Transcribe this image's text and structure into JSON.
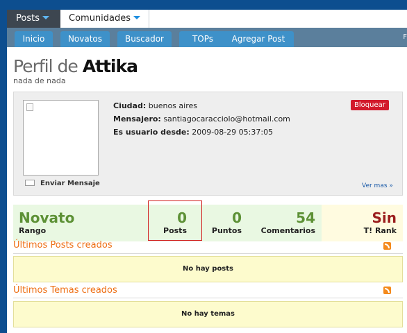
{
  "topnav": {
    "tabs": [
      {
        "label": "Posts",
        "active": true
      },
      {
        "label": "Comunidades",
        "active": false
      }
    ]
  },
  "subnav": {
    "items": [
      {
        "label": "Inicio"
      },
      {
        "label": "Novatos"
      },
      {
        "label": "Buscador"
      },
      {
        "label": "TOPs"
      },
      {
        "label": "Agregar Post"
      }
    ],
    "right_mark": "F"
  },
  "profile": {
    "title_prefix": "Perfil de",
    "username": "Attika",
    "tagline": "nada de nada",
    "send_message_label": "Enviar Mensaje",
    "block_button_label": "Bloquear",
    "see_more_label": "Ver mas »",
    "fields": [
      {
        "label": "Ciudad:",
        "value": "buenos aires"
      },
      {
        "label": "Mensajero:",
        "value": "santiagocaracciolo@hotmail.com"
      },
      {
        "label": "Es usuario desde:",
        "value": "2009-08-29 05:37:05"
      }
    ]
  },
  "stats": {
    "rank_value": "Novato",
    "rank_label": "Rango",
    "posts_value": "0",
    "posts_label": "Posts",
    "points_value": "0",
    "points_label": "Puntos",
    "comments_value": "54",
    "comments_label": "Comentarios",
    "trank_value": "Sin",
    "trank_label": "T! Rank"
  },
  "sections": {
    "latest_posts": {
      "title": "Últimos Posts creados",
      "empty_text": "No hay posts"
    },
    "latest_topics": {
      "title": "Últimos Temas creados",
      "empty_text": "No hay temas"
    }
  },
  "colors": {
    "page_bg": "#0d4e8f",
    "subnav_button": "#3e91c9",
    "accent_orange": "#ee6f14",
    "stat_green": "#5d9136",
    "stat_red": "#9b1d1d",
    "block_red": "#d21a2c"
  },
  "icons": {
    "caret": "chevron-down-icon",
    "mail": "mail-icon",
    "rss": "rss-icon",
    "avatar_placeholder": "broken-image-icon"
  }
}
